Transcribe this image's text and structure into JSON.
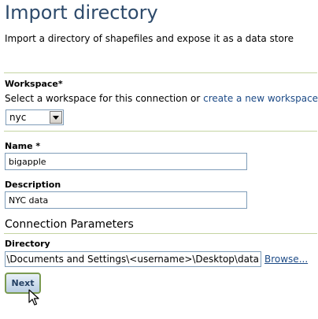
{
  "page": {
    "title": "Import directory",
    "description": "Import a directory of shapefiles and expose it as a data store"
  },
  "workspace": {
    "label": "Workspace*",
    "help_prefix": "Select a workspace for this connection or",
    "create_link": "create a new workspace",
    "selected": "nyc"
  },
  "name": {
    "label": "Name *",
    "value": "bigapple"
  },
  "description_field": {
    "label": "Description",
    "value": "NYC data"
  },
  "connection": {
    "title": "Connection Parameters",
    "directory_label": "Directory",
    "directory_value": "C:\\Documents and Settings\\<username>\\Desktop\\data",
    "browse_label": "Browse..."
  },
  "actions": {
    "next_label": "Next"
  },
  "icons": {
    "dropdown": "chevron-down-icon",
    "cursor": "mouse-pointer-icon"
  },
  "colors": {
    "title": "#2d4a6b",
    "link": "#1c4a86",
    "divider": "#c5d4a2",
    "button_border": "#7a9a50"
  }
}
